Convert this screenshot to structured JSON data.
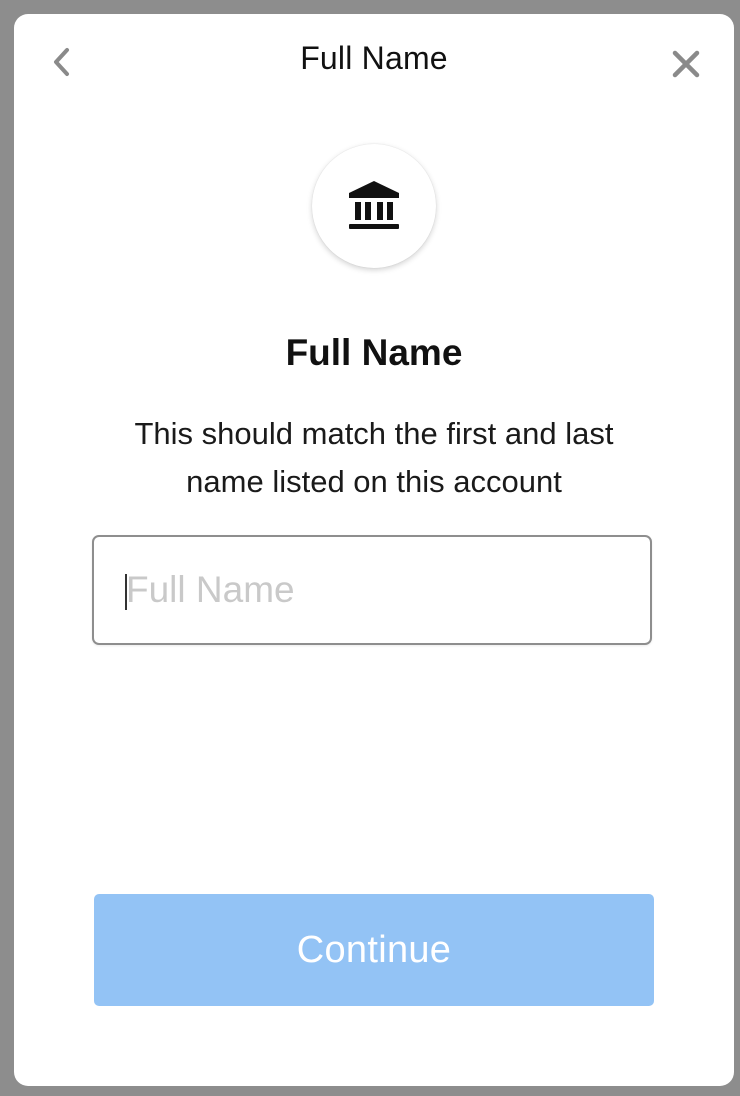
{
  "header": {
    "title": "Full Name",
    "back_icon": "chevron-left-icon",
    "close_icon": "close-icon"
  },
  "hero": {
    "icon": "bank-icon"
  },
  "main": {
    "title": "Full Name",
    "description": "This should match the first and last name listed on this account",
    "input": {
      "value": "",
      "placeholder": "Full Name"
    }
  },
  "footer": {
    "continue_label": "Continue"
  },
  "colors": {
    "backdrop": "#8d8d8d",
    "button_disabled": "#93c3f5",
    "placeholder": "#c9c9c9",
    "icon_gray": "#8a8a8a"
  }
}
